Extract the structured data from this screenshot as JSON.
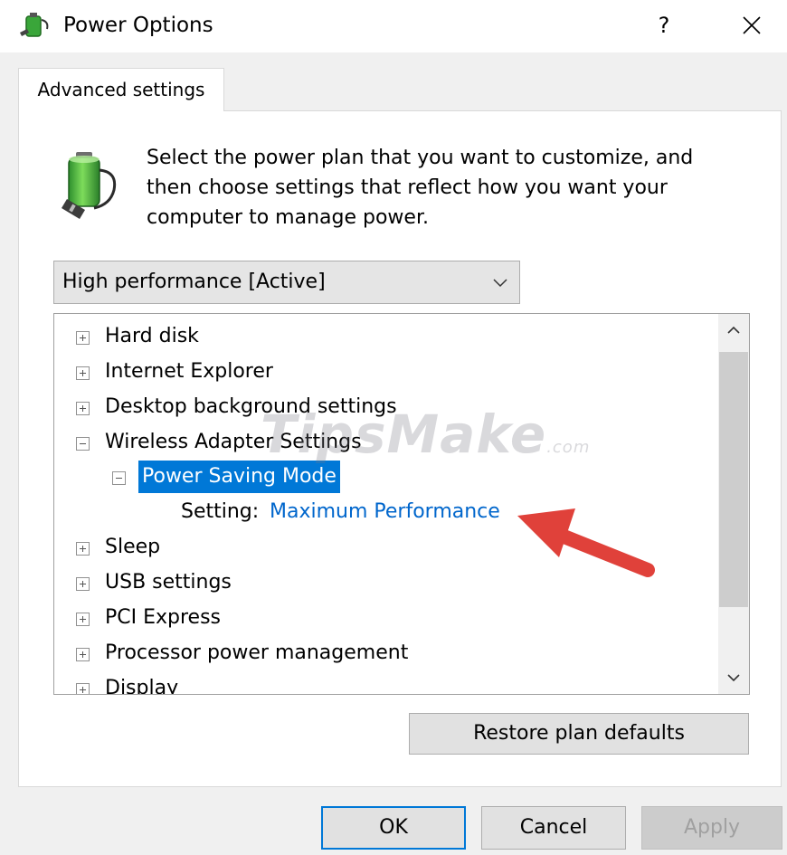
{
  "window": {
    "title": "Power Options",
    "help_label": "?",
    "icons": {
      "app": "power-options-icon",
      "close": "close-icon"
    }
  },
  "tabs": [
    {
      "label": "Advanced settings",
      "selected": true
    }
  ],
  "description": "Select the power plan that you want to customize, and then choose settings that reflect how you want your computer to manage power.",
  "plan_dropdown": {
    "selected": "High performance [Active]",
    "icon": "chevron-down-icon"
  },
  "tree": {
    "items": [
      {
        "label": "Hard disk",
        "expanded": false
      },
      {
        "label": "Internet Explorer",
        "expanded": false
      },
      {
        "label": "Desktop background settings",
        "expanded": false
      },
      {
        "label": "Wireless Adapter Settings",
        "expanded": true
      },
      {
        "label": "Power Saving Mode",
        "expanded": true,
        "selected": true
      },
      {
        "setting_label": "Setting:",
        "setting_value": "Maximum Performance"
      },
      {
        "label": "Sleep",
        "expanded": false
      },
      {
        "label": "USB settings",
        "expanded": false
      },
      {
        "label": "PCI Express",
        "expanded": false
      },
      {
        "label": "Processor power management",
        "expanded": false
      },
      {
        "label": "Display",
        "expanded": false
      }
    ],
    "scroll_position": 0.15
  },
  "watermark": {
    "main": "TipsMake",
    "suffix": ".com"
  },
  "buttons": {
    "restore": "Restore plan defaults",
    "ok": "OK",
    "cancel": "Cancel",
    "apply": "Apply"
  },
  "colors": {
    "selection": "#0078d7",
    "link_value": "#0066cc",
    "annotation_arrow": "#e0413a"
  }
}
